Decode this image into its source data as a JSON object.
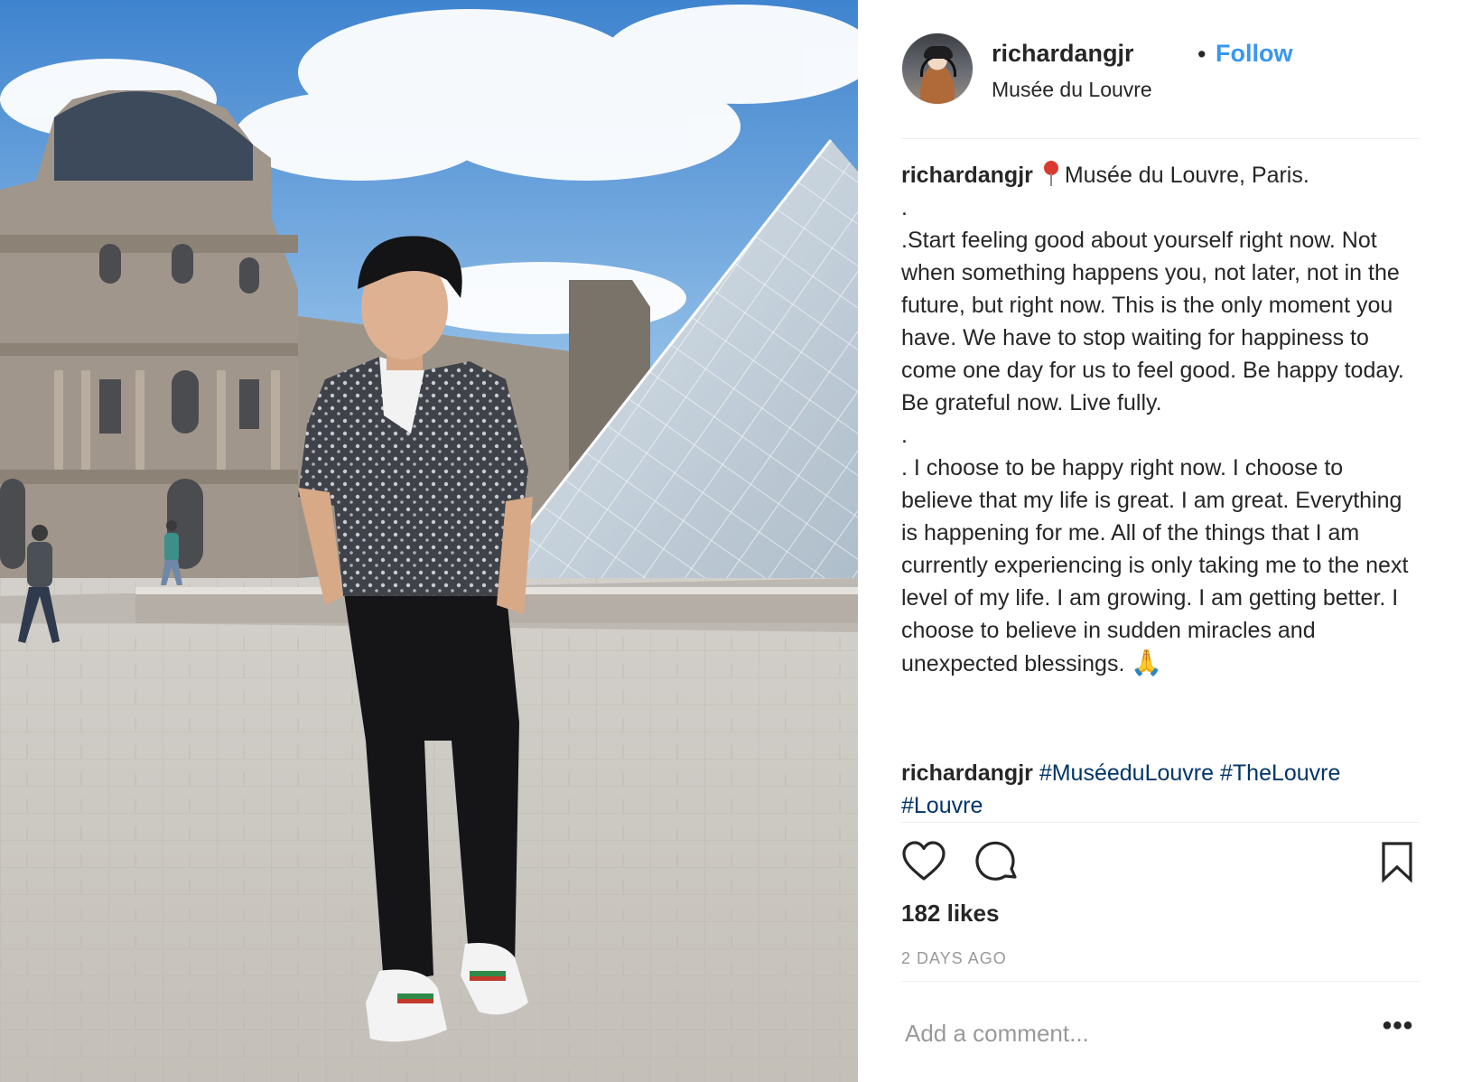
{
  "post": {
    "username": "richardangjr",
    "follow_label": "Follow",
    "separator": "•",
    "location": "Musée du Louvre",
    "caption": {
      "username": "richardangjr",
      "pin_icon": "round-pushpin-icon",
      "first_line": "Musée du Louvre, Paris.",
      "dot1": ".",
      "paragraph1": ".Start feeling good about yourself right now. Not when something happens you, not later, not in the future, but right now. This is the only moment you have. We have to stop waiting for happiness to come one day for us to feel good. Be happy today. Be grateful now. Live fully.",
      "dot2": ".",
      "paragraph2": ". I choose to be happy right now. I choose to believe that my life is great. I am great. Everything is happening for me. All of the things that I am currently experiencing is only taking me to the next level of my life. I am growing. I am getting better. I choose to believe in sudden miracles and unexpected blessings.",
      "emoji": "🙏"
    },
    "comment": {
      "username": "richardangjr",
      "hashtags": [
        "#MuséeduLouvre",
        "#TheLouvre",
        "#Louvre"
      ]
    },
    "likes": "182 likes",
    "timestamp": "2 DAYS AGO",
    "comment_placeholder": "Add a comment...",
    "more_label": "•••",
    "icons": {
      "like": "heart-icon",
      "comment": "speech-bubble-icon",
      "save": "bookmark-icon",
      "more": "ellipsis-icon"
    },
    "colors": {
      "follow": "#3897f0",
      "hashtag": "#003569",
      "muted": "#999999",
      "text": "#262626"
    }
  }
}
